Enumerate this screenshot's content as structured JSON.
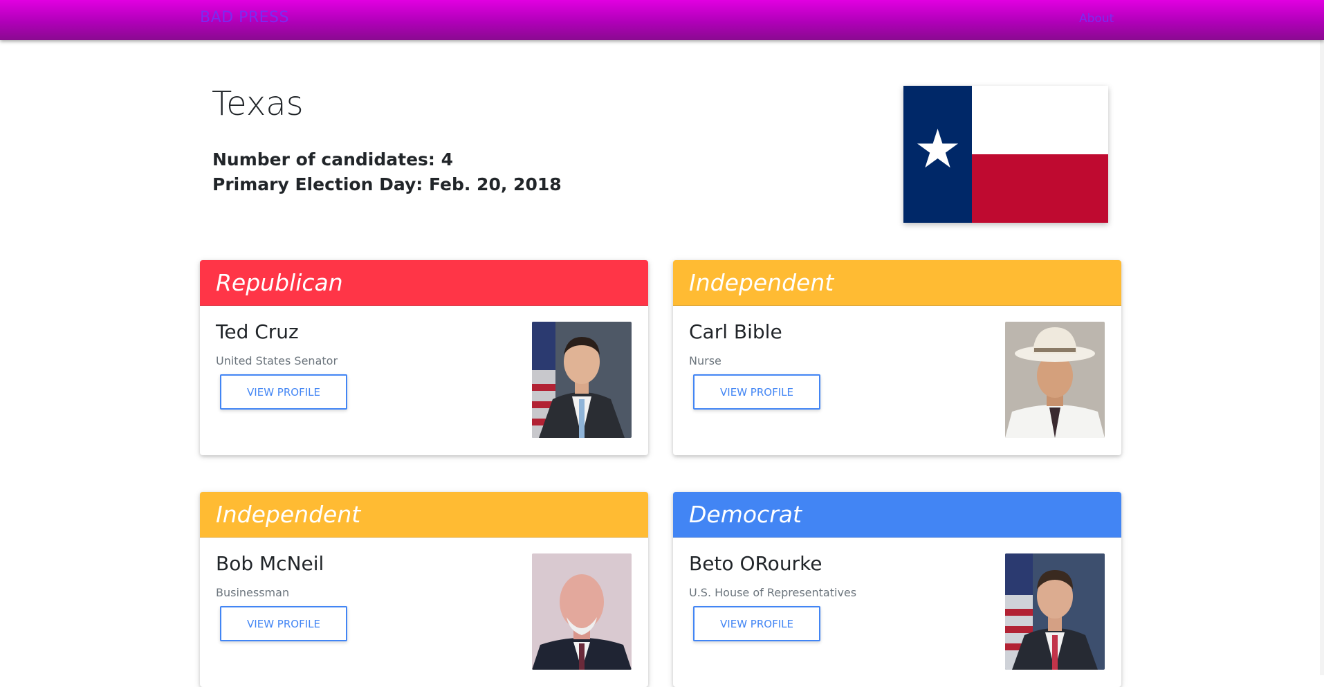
{
  "navbar": {
    "brand": "BAD PRESS",
    "about_label": "About"
  },
  "state": {
    "name": "Texas",
    "candidates_line": "Number of candidates: 4",
    "election_line": "Primary Election Day: Feb. 20, 2018"
  },
  "colors": {
    "republican": "#ff3547",
    "independent": "#ffbb33",
    "democrat": "#4285f4",
    "flag_blue": "#002868",
    "flag_red": "#bf0a30"
  },
  "candidates": [
    {
      "party": "Republican",
      "name": "Ted Cruz",
      "office": "United States Senator",
      "button": "VIEW PROFILE"
    },
    {
      "party": "Independent",
      "name": "Carl Bible",
      "office": "Nurse",
      "button": "VIEW PROFILE"
    },
    {
      "party": "Independent",
      "name": "Bob McNeil",
      "office": "Businessman",
      "button": "VIEW PROFILE"
    },
    {
      "party": "Democrat",
      "name": "Beto ORourke",
      "office": "U.S. House of Representatives",
      "button": "VIEW PROFILE"
    }
  ]
}
